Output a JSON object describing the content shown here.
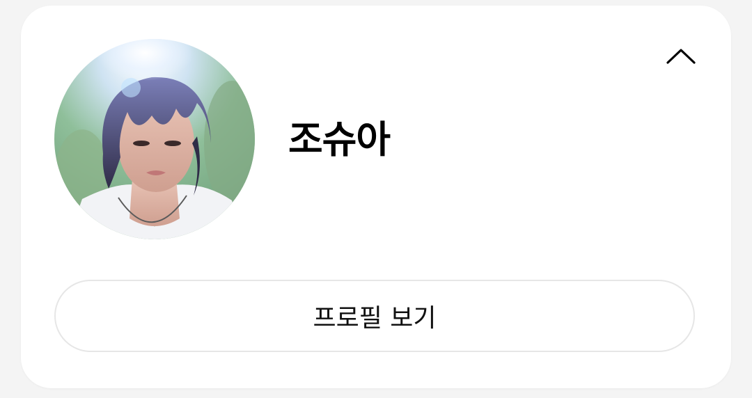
{
  "profile": {
    "name": "조슈아",
    "avatar_icon": "user-avatar-photo"
  },
  "actions": {
    "view_profile_label": "프로필 보기",
    "collapse_icon": "chevron-up-icon"
  },
  "colors": {
    "card_background": "#ffffff",
    "page_background": "#f4f4f4",
    "button_border": "#e6e6e6",
    "text": "#000000"
  }
}
